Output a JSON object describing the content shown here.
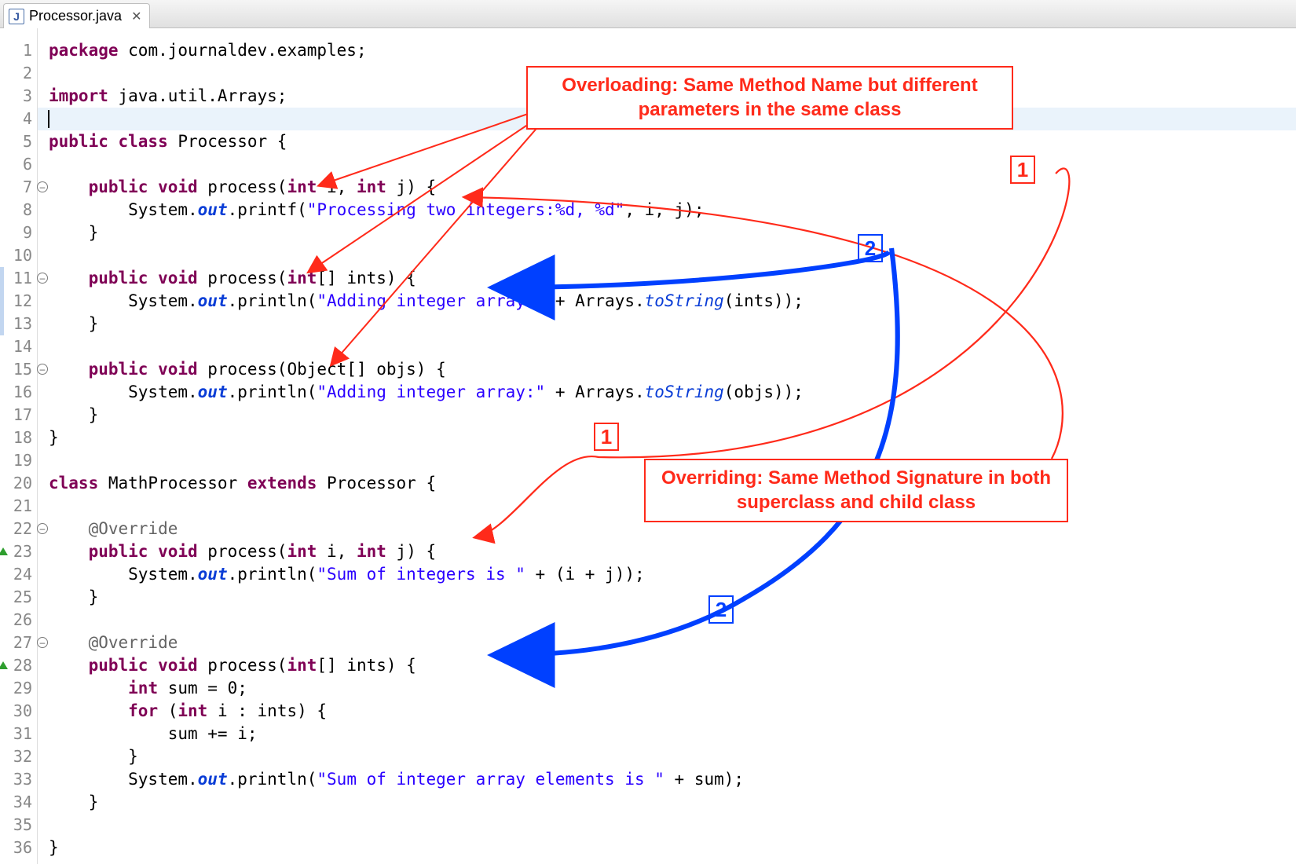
{
  "tab": {
    "filename": "Processor.java",
    "filetype_icon": "J",
    "close_glyph": "✕"
  },
  "lines": {
    "count": 36
  },
  "gutter": {
    "fold_lines": [
      7,
      11,
      15,
      22,
      27
    ],
    "override_markers": [
      23,
      28
    ],
    "warn_stripes": [
      {
        "from": 11,
        "to": 13
      }
    ]
  },
  "code_rows": [
    [
      [
        "kw",
        "package"
      ],
      [
        "plain",
        " com.journaldev.examples;"
      ]
    ],
    [
      [
        "plain",
        ""
      ]
    ],
    [
      [
        "kw",
        "import"
      ],
      [
        "plain",
        " java.util.Arrays;"
      ]
    ],
    "__CURSOR__",
    [
      [
        "kw",
        "public class"
      ],
      [
        "plain",
        " Processor {"
      ]
    ],
    [
      [
        "plain",
        ""
      ]
    ],
    [
      [
        "plain",
        "    "
      ],
      [
        "kw",
        "public void"
      ],
      [
        "plain",
        " process("
      ],
      [
        "kw",
        "int"
      ],
      [
        "plain",
        " i, "
      ],
      [
        "kw",
        "int"
      ],
      [
        "plain",
        " j) {"
      ]
    ],
    [
      [
        "plain",
        "        System."
      ],
      [
        "st",
        "out"
      ],
      [
        "plain",
        ".printf("
      ],
      [
        "str",
        "\"Processing two integers:%d, %d\""
      ],
      [
        "plain",
        ", i, j);"
      ]
    ],
    [
      [
        "plain",
        "    }"
      ]
    ],
    [
      [
        "plain",
        ""
      ]
    ],
    [
      [
        "plain",
        "    "
      ],
      [
        "kw",
        "public void"
      ],
      [
        "plain",
        " process("
      ],
      [
        "kw",
        "int"
      ],
      [
        "plain",
        "[] ints) {"
      ]
    ],
    [
      [
        "plain",
        "        System."
      ],
      [
        "st",
        "out"
      ],
      [
        "plain",
        ".println("
      ],
      [
        "str",
        "\"Adding integer array:\""
      ],
      [
        "plain",
        " + Arrays."
      ],
      [
        "mstatic",
        "toString"
      ],
      [
        "plain",
        "(ints));"
      ]
    ],
    [
      [
        "plain",
        "    }"
      ]
    ],
    [
      [
        "plain",
        ""
      ]
    ],
    [
      [
        "plain",
        "    "
      ],
      [
        "kw",
        "public void"
      ],
      [
        "plain",
        " process(Object[] objs) {"
      ]
    ],
    [
      [
        "plain",
        "        System."
      ],
      [
        "st",
        "out"
      ],
      [
        "plain",
        ".println("
      ],
      [
        "str",
        "\"Adding integer array:\""
      ],
      [
        "plain",
        " + Arrays."
      ],
      [
        "mstatic",
        "toString"
      ],
      [
        "plain",
        "(objs));"
      ]
    ],
    [
      [
        "plain",
        "    }"
      ]
    ],
    [
      [
        "plain",
        "}"
      ]
    ],
    [
      [
        "plain",
        ""
      ]
    ],
    [
      [
        "kw",
        "class"
      ],
      [
        "plain",
        " MathProcessor "
      ],
      [
        "kw",
        "extends"
      ],
      [
        "plain",
        " Processor {"
      ]
    ],
    [
      [
        "plain",
        ""
      ]
    ],
    [
      [
        "plain",
        "    "
      ],
      [
        "ann",
        "@Override"
      ]
    ],
    [
      [
        "plain",
        "    "
      ],
      [
        "kw",
        "public void"
      ],
      [
        "plain",
        " process("
      ],
      [
        "kw",
        "int"
      ],
      [
        "plain",
        " i, "
      ],
      [
        "kw",
        "int"
      ],
      [
        "plain",
        " j) {"
      ]
    ],
    [
      [
        "plain",
        "        System."
      ],
      [
        "st",
        "out"
      ],
      [
        "plain",
        ".println("
      ],
      [
        "str",
        "\"Sum of integers is \""
      ],
      [
        "plain",
        " + (i + j));"
      ]
    ],
    [
      [
        "plain",
        "    }"
      ]
    ],
    [
      [
        "plain",
        ""
      ]
    ],
    [
      [
        "plain",
        "    "
      ],
      [
        "ann",
        "@Override"
      ]
    ],
    [
      [
        "plain",
        "    "
      ],
      [
        "kw",
        "public void"
      ],
      [
        "plain",
        " process("
      ],
      [
        "kw",
        "int"
      ],
      [
        "plain",
        "[] ints) {"
      ]
    ],
    [
      [
        "plain",
        "        "
      ],
      [
        "kw",
        "int"
      ],
      [
        "plain",
        " sum = 0;"
      ]
    ],
    [
      [
        "plain",
        "        "
      ],
      [
        "kw",
        "for"
      ],
      [
        "plain",
        " ("
      ],
      [
        "kw",
        "int"
      ],
      [
        "plain",
        " i : ints) {"
      ]
    ],
    [
      [
        "plain",
        "            sum += i;"
      ]
    ],
    [
      [
        "plain",
        "        }"
      ]
    ],
    [
      [
        "plain",
        "        System."
      ],
      [
        "st",
        "out"
      ],
      [
        "plain",
        ".println("
      ],
      [
        "str",
        "\"Sum of integer array elements is \""
      ],
      [
        "plain",
        " + sum);"
      ]
    ],
    [
      [
        "plain",
        "    }"
      ]
    ],
    [
      [
        "plain",
        ""
      ]
    ],
    [
      [
        "plain",
        "}"
      ]
    ]
  ],
  "annotations": {
    "callout_overloading": "Overloading: Same Method Name but different\nparameters in the same class",
    "callout_overriding": "Overriding: Same Method Signature in\nboth superclass and child class",
    "num1": "1",
    "num2": "2"
  }
}
